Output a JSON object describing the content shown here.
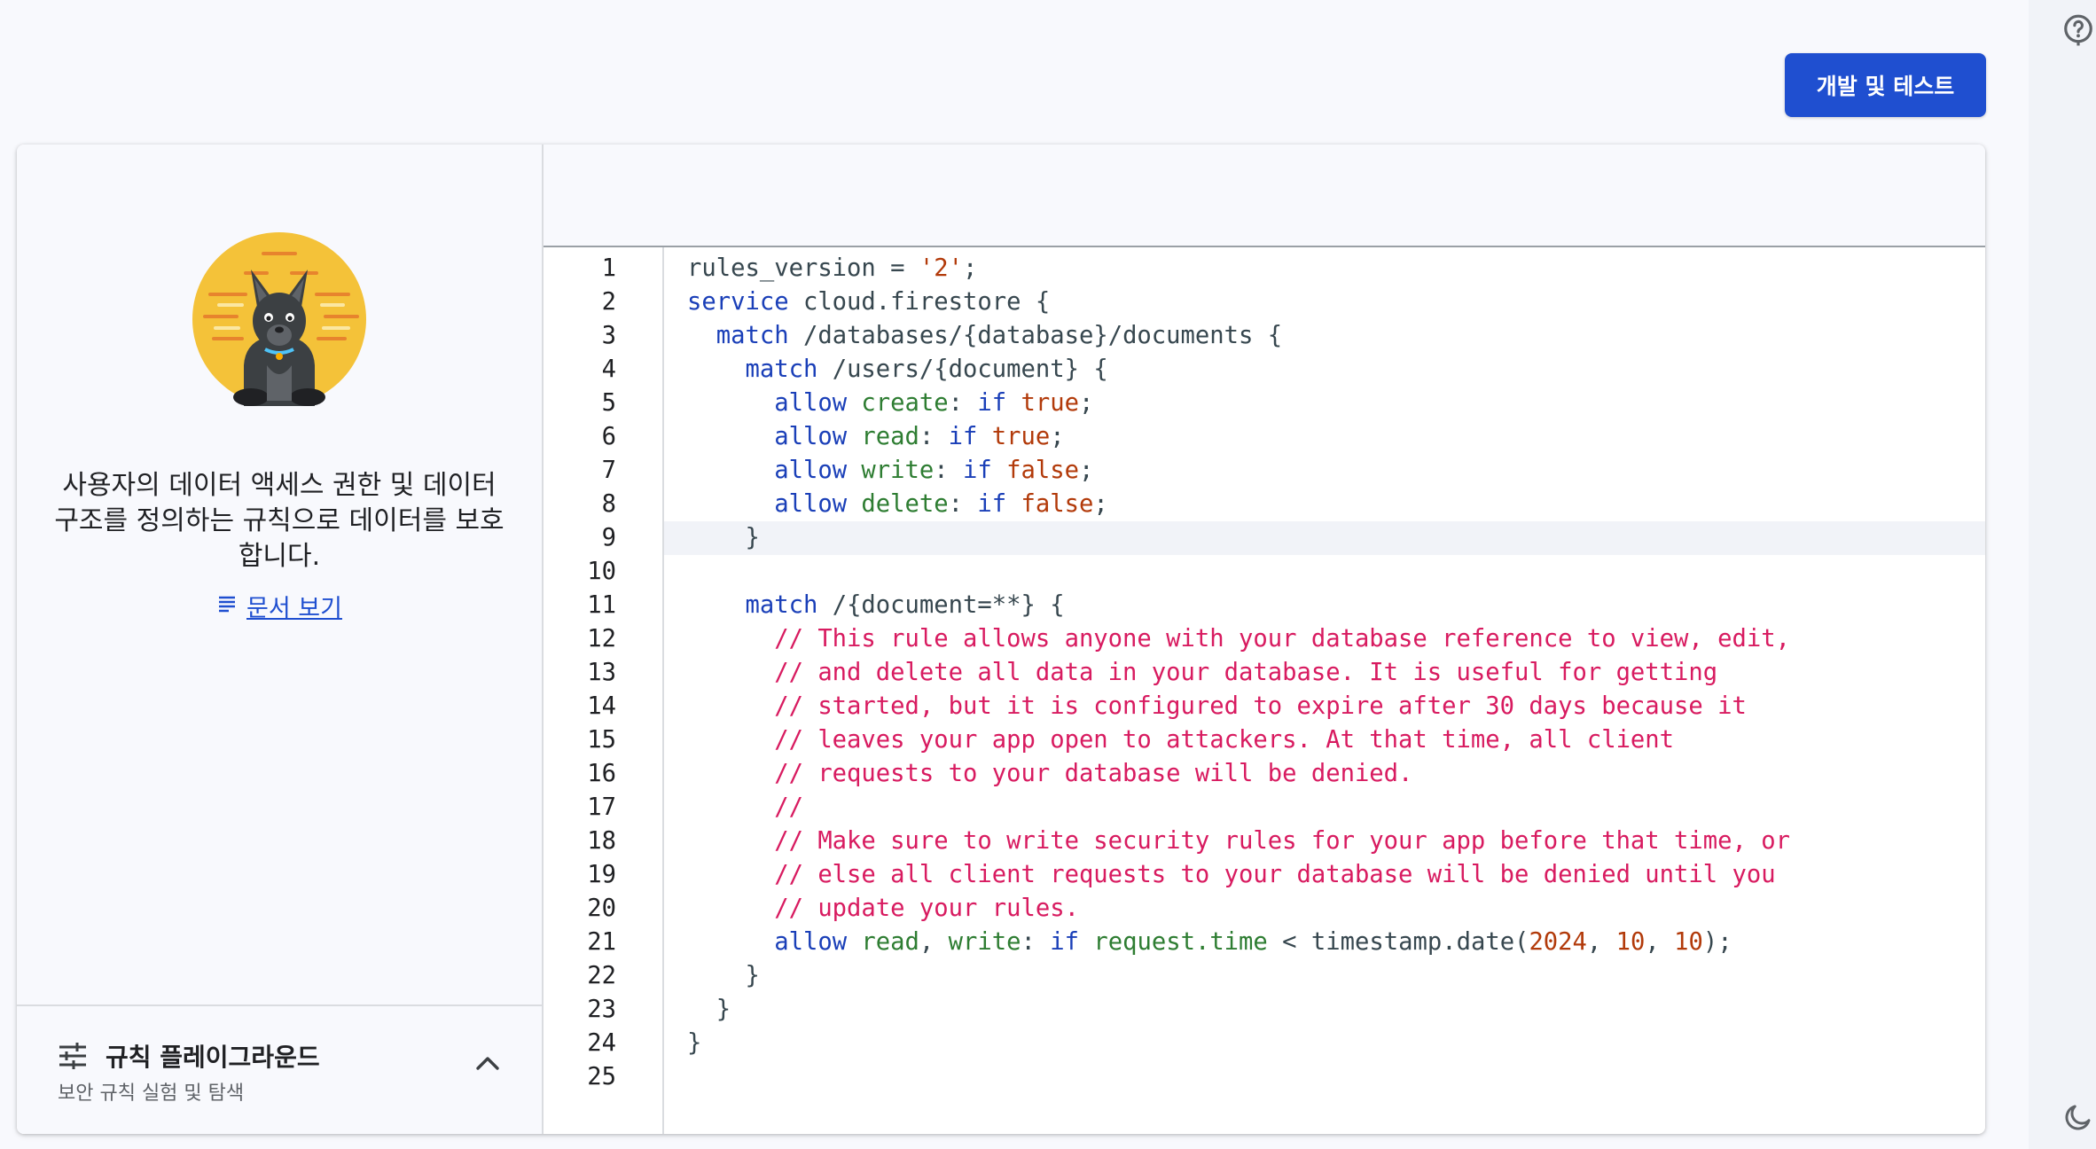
{
  "header": {
    "deploy_button": "개발 및 테스트"
  },
  "left_panel": {
    "intro_line1": "사용자의 데이터 액세스 권한 및 데이터",
    "intro_line2": "구조를 정의하는 규칙으로 데이터를 보호",
    "intro_line3": "합니다.",
    "docs_link": "문서 보기",
    "playground_title": "규칙 플레이그라운드",
    "playground_subtitle": "보안 규칙 실험 및 탐색"
  },
  "editor": {
    "highlighted_line": 9,
    "lines": [
      {
        "n": "1",
        "tokens": [
          {
            "t": "rules_version = ",
            "c": "p"
          },
          {
            "t": "'2'",
            "c": "r"
          },
          {
            "t": ";",
            "c": "p"
          }
        ]
      },
      {
        "n": "2",
        "tokens": [
          {
            "t": "service",
            "c": "k"
          },
          {
            "t": " cloud.firestore {",
            "c": "p"
          }
        ]
      },
      {
        "n": "3",
        "tokens": [
          {
            "t": "  ",
            "c": "p"
          },
          {
            "t": "match",
            "c": "k"
          },
          {
            "t": " /databases/{database}/documents {",
            "c": "p"
          }
        ]
      },
      {
        "n": "4",
        "tokens": [
          {
            "t": "    ",
            "c": "p"
          },
          {
            "t": "match",
            "c": "k"
          },
          {
            "t": " /users/{document} {",
            "c": "p"
          }
        ]
      },
      {
        "n": "5",
        "tokens": [
          {
            "t": "      ",
            "c": "p"
          },
          {
            "t": "allow",
            "c": "k"
          },
          {
            "t": " create",
            "c": "g"
          },
          {
            "t": ": ",
            "c": "p"
          },
          {
            "t": "if",
            "c": "k"
          },
          {
            "t": " true",
            "c": "r"
          },
          {
            "t": ";",
            "c": "p"
          }
        ]
      },
      {
        "n": "6",
        "tokens": [
          {
            "t": "      ",
            "c": "p"
          },
          {
            "t": "allow",
            "c": "k"
          },
          {
            "t": " read",
            "c": "g"
          },
          {
            "t": ": ",
            "c": "p"
          },
          {
            "t": "if",
            "c": "k"
          },
          {
            "t": " true",
            "c": "r"
          },
          {
            "t": ";",
            "c": "p"
          }
        ]
      },
      {
        "n": "7",
        "tokens": [
          {
            "t": "      ",
            "c": "p"
          },
          {
            "t": "allow",
            "c": "k"
          },
          {
            "t": " write",
            "c": "g"
          },
          {
            "t": ": ",
            "c": "p"
          },
          {
            "t": "if",
            "c": "k"
          },
          {
            "t": " false",
            "c": "r"
          },
          {
            "t": ";",
            "c": "p"
          }
        ]
      },
      {
        "n": "8",
        "tokens": [
          {
            "t": "      ",
            "c": "p"
          },
          {
            "t": "allow",
            "c": "k"
          },
          {
            "t": " delete",
            "c": "g"
          },
          {
            "t": ": ",
            "c": "p"
          },
          {
            "t": "if",
            "c": "k"
          },
          {
            "t": " false",
            "c": "r"
          },
          {
            "t": ";",
            "c": "p"
          }
        ]
      },
      {
        "n": "9",
        "tokens": [
          {
            "t": "    }",
            "c": "p"
          }
        ]
      },
      {
        "n": "10",
        "tokens": []
      },
      {
        "n": "11",
        "tokens": [
          {
            "t": "    ",
            "c": "p"
          },
          {
            "t": "match",
            "c": "k"
          },
          {
            "t": " /{document=**} {",
            "c": "p"
          }
        ]
      },
      {
        "n": "12",
        "tokens": [
          {
            "t": "      // This rule allows anyone with your database reference to view, edit,",
            "c": "c"
          }
        ]
      },
      {
        "n": "13",
        "tokens": [
          {
            "t": "      // and delete all data in your database. It is useful for getting",
            "c": "c"
          }
        ]
      },
      {
        "n": "14",
        "tokens": [
          {
            "t": "      // started, but it is configured to expire after 30 days because it",
            "c": "c"
          }
        ]
      },
      {
        "n": "15",
        "tokens": [
          {
            "t": "      // leaves your app open to attackers. At that time, all client",
            "c": "c"
          }
        ]
      },
      {
        "n": "16",
        "tokens": [
          {
            "t": "      // requests to your database will be denied.",
            "c": "c"
          }
        ]
      },
      {
        "n": "17",
        "tokens": [
          {
            "t": "      //",
            "c": "c"
          }
        ]
      },
      {
        "n": "18",
        "tokens": [
          {
            "t": "      // Make sure to write security rules for your app before that time, or",
            "c": "c"
          }
        ]
      },
      {
        "n": "19",
        "tokens": [
          {
            "t": "      // else all client requests to your database will be denied until you",
            "c": "c"
          }
        ]
      },
      {
        "n": "20",
        "tokens": [
          {
            "t": "      // update your rules.",
            "c": "c"
          }
        ]
      },
      {
        "n": "21",
        "tokens": [
          {
            "t": "      ",
            "c": "p"
          },
          {
            "t": "allow",
            "c": "k"
          },
          {
            "t": " read",
            "c": "g"
          },
          {
            "t": ", ",
            "c": "p"
          },
          {
            "t": "write",
            "c": "g"
          },
          {
            "t": ": ",
            "c": "p"
          },
          {
            "t": "if",
            "c": "k"
          },
          {
            "t": " request.time",
            "c": "g"
          },
          {
            "t": " < timestamp.date(",
            "c": "p"
          },
          {
            "t": "2024",
            "c": "r"
          },
          {
            "t": ", ",
            "c": "p"
          },
          {
            "t": "10",
            "c": "r"
          },
          {
            "t": ", ",
            "c": "p"
          },
          {
            "t": "10",
            "c": "r"
          },
          {
            "t": ");",
            "c": "p"
          }
        ]
      },
      {
        "n": "22",
        "tokens": [
          {
            "t": "    }",
            "c": "p"
          }
        ]
      },
      {
        "n": "23",
        "tokens": [
          {
            "t": "  }",
            "c": "p"
          }
        ]
      },
      {
        "n": "24",
        "tokens": [
          {
            "t": "}",
            "c": "p"
          }
        ]
      },
      {
        "n": "25",
        "tokens": []
      }
    ]
  },
  "icons": {
    "help": "help-circle-icon",
    "theme": "dark-mode-moon-icon",
    "docs": "notes-lines-icon",
    "playground": "tune-sliders-icon",
    "chevron": "chevron-up-icon"
  },
  "colors": {
    "primary": "#1f4fd0",
    "keyword": "#1a3fb8",
    "property": "#2e7d32",
    "literal": "#b23a0a",
    "comment": "#d81b60"
  }
}
